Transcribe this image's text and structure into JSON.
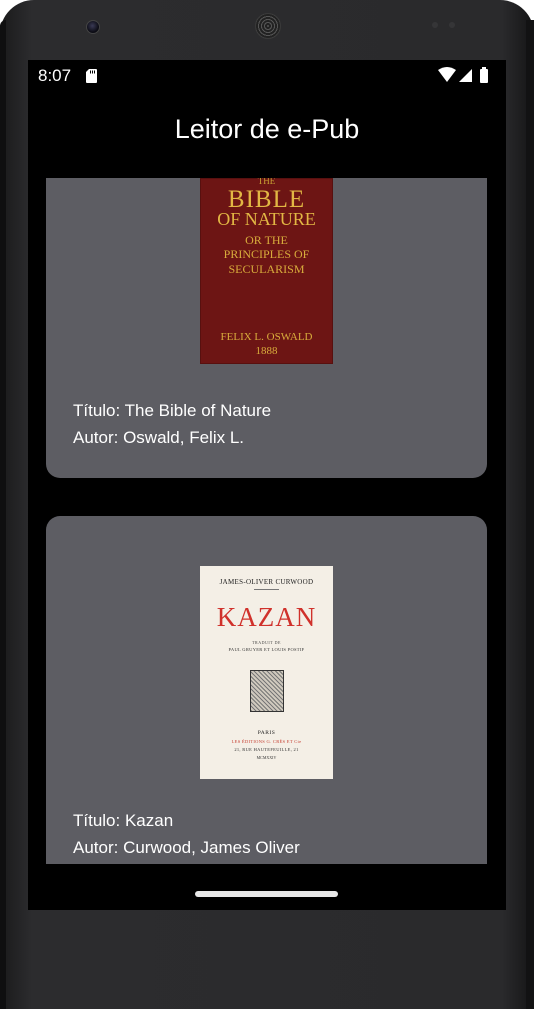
{
  "status_bar": {
    "time": "8:07",
    "icons": [
      "sd-card-icon",
      "wifi-icon",
      "cellular-signal-icon",
      "battery-icon"
    ]
  },
  "app_bar": {
    "title": "Leitor de e-Pub"
  },
  "books": [
    {
      "title_line": "Título: The Bible of Nature",
      "author_line": "Autor: Oswald, Felix L.",
      "cover": {
        "line_the": "THE",
        "line_bible": "BIBLE",
        "line_nature": "OF NATURE",
        "line_or": "OR THE",
        "line_principles": "PRINCIPLES OF",
        "line_secularism": "SECULARISM",
        "line_author": "FELIX L. OSWALD",
        "line_year": "1888",
        "background": "#6d1514",
        "text_color": "#e2b744"
      }
    },
    {
      "title_line": "Título: Kazan",
      "author_line": "Autor: Curwood, James Oliver",
      "cover": {
        "line_author": "JAMES-OLIVER CURWOOD",
        "line_title": "KAZAN",
        "line_traduit": "TRADUIT DE",
        "line_translators": "PAUL GRUYER ET LOUIS POSTIF",
        "line_city": "PARIS",
        "line_publisher": "LES ÉDITIONS G. CRÈS ET Cie",
        "line_address": "21, RUE HAUTEFEUILLE, 21",
        "line_year": "MCMXXIV",
        "background": "#f4efe6",
        "title_color": "#d0312b"
      }
    }
  ],
  "colors": {
    "screen_bg": "#000000",
    "card_bg": "#5d5d63",
    "text": "#ffffff"
  }
}
